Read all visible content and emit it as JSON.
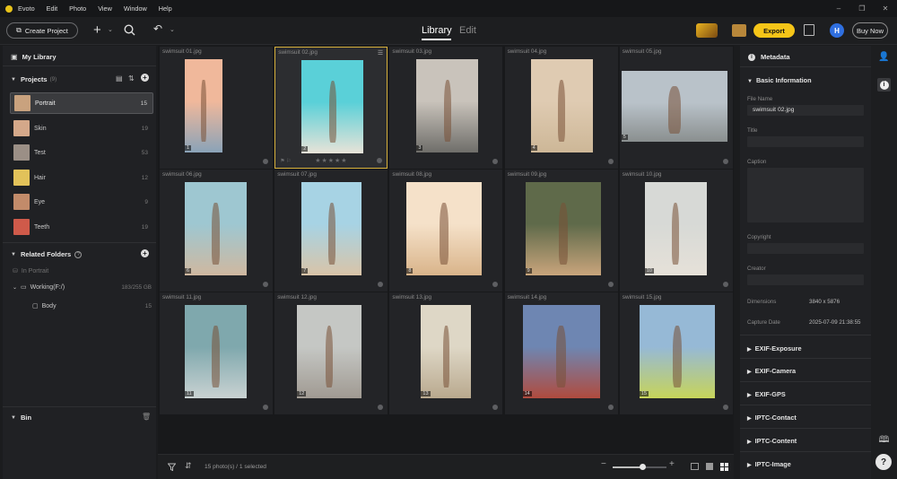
{
  "app": {
    "name": "Evoto",
    "menu": [
      "Evoto",
      "Edit",
      "Photo",
      "View",
      "Window",
      "Help"
    ]
  },
  "toolbar": {
    "create_project": "Create Project",
    "tabs": [
      {
        "label": "Library",
        "active": true
      },
      {
        "label": "Edit",
        "active": false
      }
    ],
    "export": "Export",
    "avatar": "H",
    "buy_now": "Buy Now"
  },
  "sidebar": {
    "my_library": "My Library",
    "projects": {
      "label": "Projects",
      "count": "(9)",
      "items": [
        {
          "label": "Portrait",
          "count": "15",
          "color": "#c9a27e",
          "active": true
        },
        {
          "label": "Skin",
          "count": "19",
          "color": "#d4a88a"
        },
        {
          "label": "Test",
          "count": "53",
          "color": "#9b8f86"
        },
        {
          "label": "Hair",
          "count": "12",
          "color": "#e2c25a"
        },
        {
          "label": "Eye",
          "count": "9",
          "color": "#c28b6a"
        },
        {
          "label": "Teeth",
          "count": "19",
          "color": "#cf5a4a"
        }
      ]
    },
    "related_folders": {
      "label": "Related Folders",
      "in_portrait": "In Portrait",
      "working": {
        "label": "Working(F:/)",
        "size": "183/255 GB"
      },
      "body": {
        "label": "Body",
        "count": "15"
      }
    },
    "bin": {
      "label": "Bin"
    }
  },
  "photos": [
    {
      "name": "swimsuit 01.jpg",
      "num": "1",
      "colors": [
        "#f0b89b",
        "#8aa3b8"
      ]
    },
    {
      "name": "swimsuit 02.jpg",
      "num": "2",
      "colors": [
        "#5ad0d8",
        "#e8e3d8"
      ],
      "selected": true
    },
    {
      "name": "swimsuit 03.jpg",
      "num": "3",
      "colors": [
        "#c9c3bb",
        "#6f6e6a"
      ]
    },
    {
      "name": "swimsuit 04.jpg",
      "num": "4",
      "colors": [
        "#dfcbb2",
        "#cdb797"
      ]
    },
    {
      "name": "swimsuit 05.jpg",
      "num": "5",
      "colors": [
        "#b9c2c9",
        "#8a8f8f"
      ]
    },
    {
      "name": "swimsuit 06.jpg",
      "num": "6",
      "colors": [
        "#9ec7d1",
        "#cfb8a0"
      ]
    },
    {
      "name": "swimsuit 07.jpg",
      "num": "7",
      "colors": [
        "#a7d3e4",
        "#d9c4a8"
      ]
    },
    {
      "name": "swimsuit 08.jpg",
      "num": "8",
      "colors": [
        "#f5e1c9",
        "#d9b48a"
      ]
    },
    {
      "name": "swimsuit 09.jpg",
      "num": "9",
      "colors": [
        "#5f6a4a",
        "#c9a57c"
      ]
    },
    {
      "name": "swimsuit 10.jpg",
      "num": "10",
      "colors": [
        "#d7d9d6",
        "#e6e1d8"
      ]
    },
    {
      "name": "swimsuit 11.jpg",
      "num": "11",
      "colors": [
        "#7fa8ad",
        "#c9d2d2"
      ]
    },
    {
      "name": "swimsuit 12.jpg",
      "num": "12",
      "colors": [
        "#c5c7c4",
        "#a09a92"
      ]
    },
    {
      "name": "swimsuit 13.jpg",
      "num": "13",
      "colors": [
        "#ded7c6",
        "#b9a98e"
      ]
    },
    {
      "name": "swimsuit 14.jpg",
      "num": "14",
      "colors": [
        "#6e86b2",
        "#b04b3e"
      ]
    },
    {
      "name": "swimsuit 15.jpg",
      "num": "15",
      "colors": [
        "#96b9d6",
        "#c7d45a"
      ]
    }
  ],
  "status": {
    "count": "15 photo(s) / 1 selected",
    "zoom": 0.55
  },
  "metadata": {
    "title": "Metadata",
    "basic": "Basic Information",
    "file_name_label": "File Name",
    "file_name": "swimsuit 02.jpg",
    "title_label": "Title",
    "caption_label": "Caption",
    "copyright_label": "Copyright",
    "creator_label": "Creator",
    "dimensions_label": "Dimensions",
    "dimensions": "3840 x 5876",
    "capture_label": "Capture Date",
    "capture": "2025-07-09 21:38:55",
    "sections": [
      "EXIF-Exposure",
      "EXIF-Camera",
      "EXIF-GPS",
      "IPTC-Contact",
      "IPTC-Content",
      "IPTC-Image"
    ]
  },
  "colors": {
    "accent": "#f5c518",
    "selected_border": "#d8b13c",
    "avatar": "#2f6fe0"
  }
}
